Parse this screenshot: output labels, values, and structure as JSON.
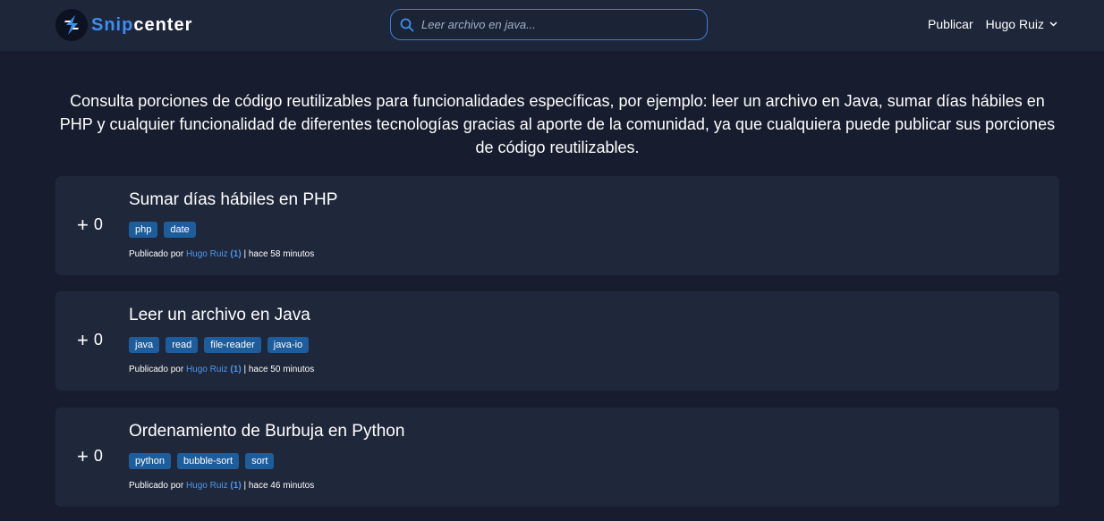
{
  "nav": {
    "brand_a": "Snip",
    "brand_b": "center",
    "search_placeholder": "Leer archivo en java...",
    "publish_label": "Publicar",
    "user_name": "Hugo Ruiz"
  },
  "intro": "Consulta porciones de código reutilizables para funcionalidades específicas, por ejemplo: leer un archivo en Java, sumar días hábiles en PHP y cualquier funcionalidad de diferentes tecnologías gracias al aporte de la comunidad, ya que cualquiera puede publicar sus porciones de código reutilizables.",
  "colors": {
    "background": "#171d2e",
    "navbar": "#1e2639",
    "card": "#1f273a",
    "accent": "#3e8ef0",
    "tag": "#1d5d9b"
  },
  "snippets": [
    {
      "vote_plus": "+",
      "votes": "0",
      "title": "Sumar días hábiles en PHP",
      "tags": [
        "php",
        "date"
      ],
      "published_by": "Publicado por",
      "author": "Hugo Ruiz",
      "author_count": "(1)",
      "separator": "|",
      "time": "hace 58 minutos"
    },
    {
      "vote_plus": "+",
      "votes": "0",
      "title": "Leer un archivo en Java",
      "tags": [
        "java",
        "read",
        "file-reader",
        "java-io"
      ],
      "published_by": "Publicado por",
      "author": "Hugo Ruiz",
      "author_count": "(1)",
      "separator": "|",
      "time": "hace 50 minutos"
    },
    {
      "vote_plus": "+",
      "votes": "0",
      "title": "Ordenamiento de Burbuja en Python",
      "tags": [
        "python",
        "bubble-sort",
        "sort"
      ],
      "published_by": "Publicado por",
      "author": "Hugo Ruiz",
      "author_count": "(1)",
      "separator": "|",
      "time": "hace 46 minutos"
    }
  ]
}
